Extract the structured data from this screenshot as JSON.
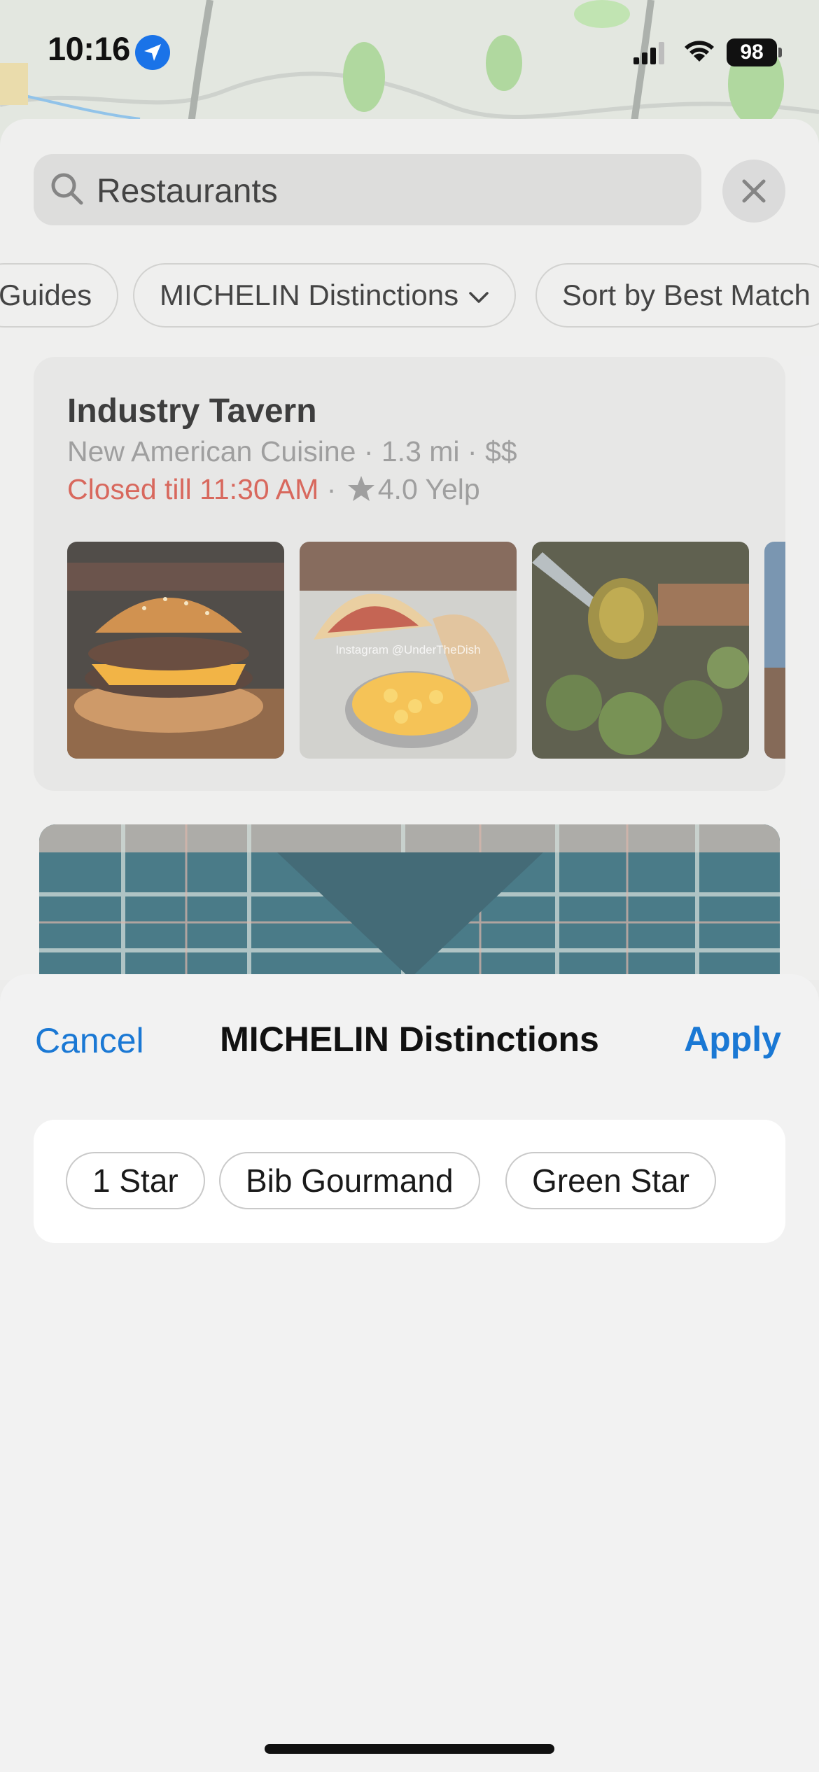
{
  "status_bar": {
    "time": "10:16",
    "battery": "98"
  },
  "search": {
    "query": "Restaurants"
  },
  "filter_chips": [
    {
      "label": "Guides"
    },
    {
      "label": "MICHELIN Distinctions"
    },
    {
      "label": "Sort by Best Match"
    }
  ],
  "result": {
    "name": "Industry Tavern",
    "meta": "New American Cuisine · 1.3 mi · $$",
    "hours": "Closed till 11:30 AM",
    "separator": " · ",
    "rating": "4.0 Yelp",
    "photo_watermark": "Instagram @UnderTheDish"
  },
  "filter_sheet": {
    "cancel_label": "Cancel",
    "title": "MICHELIN Distinctions",
    "apply_label": "Apply",
    "options": [
      {
        "label": "1 Star"
      },
      {
        "label": "Bib Gourmand"
      },
      {
        "label": "Green Star"
      }
    ]
  },
  "colors": {
    "accent": "#1a78d4",
    "closed": "#d0473a"
  }
}
